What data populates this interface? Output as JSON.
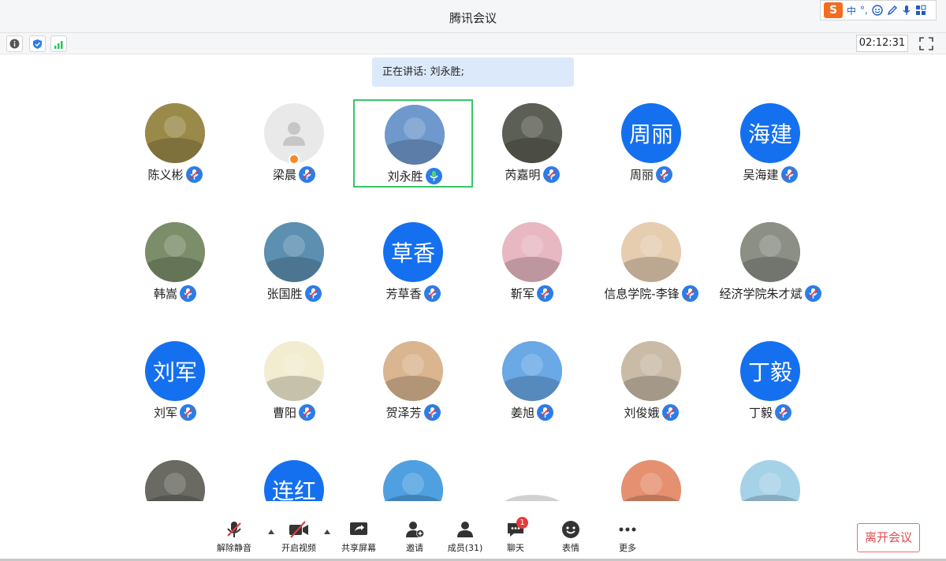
{
  "window": {
    "title": "腾讯会议"
  },
  "ime": {
    "lang": "中",
    "dot": "°,",
    "icons": [
      "smile-icon",
      "pen-icon",
      "mic-icon",
      "grid-icon"
    ]
  },
  "toolbar": {
    "timer": "02:12:31"
  },
  "speaking": {
    "text": "正在讲话: 刘永胜;"
  },
  "participants": [
    {
      "name": "陈义彬",
      "initials": "",
      "photo": "#9a8a4a"
    },
    {
      "name": "梁晨",
      "initials": "",
      "photo": "#e9e9e9"
    },
    {
      "name": "刘永胜",
      "initials": "",
      "photo": "#6f99cc"
    },
    {
      "name": "芮嘉明",
      "initials": "",
      "photo": "#5c5f55"
    },
    {
      "name": "周丽",
      "initials": "周丽",
      "photo": "#1470ef"
    },
    {
      "name": "吴海建",
      "initials": "海建",
      "photo": "#1470ef"
    },
    {
      "name": "韩嵩",
      "initials": "",
      "photo": "#7c8d6a"
    },
    {
      "name": "张国胜",
      "initials": "",
      "photo": "#5c8fb0"
    },
    {
      "name": "芳草香",
      "initials": "草香",
      "photo": "#1470ef"
    },
    {
      "name": "靳军",
      "initials": "",
      "photo": "#e8b8c2"
    },
    {
      "name": "信息学院-李锋",
      "initials": "",
      "photo": "#e6cdb0"
    },
    {
      "name": "经济学院朱才斌",
      "initials": "",
      "photo": "#8b8f85"
    },
    {
      "name": "刘军",
      "initials": "刘军",
      "photo": "#1470ef"
    },
    {
      "name": "曹阳",
      "initials": "",
      "photo": "#f2ecd0"
    },
    {
      "name": "贺泽芳",
      "initials": "",
      "photo": "#d9b590"
    },
    {
      "name": "姜旭",
      "initials": "",
      "photo": "#6aa8e6"
    },
    {
      "name": "刘俊娥",
      "initials": "",
      "photo": "#c9bba6"
    },
    {
      "name": "丁毅",
      "initials": "丁毅",
      "photo": "#1470ef"
    },
    {
      "name": "",
      "initials": "",
      "photo": "#6a6a62"
    },
    {
      "name": "",
      "initials": "连红",
      "photo": "#1470ef"
    },
    {
      "name": "",
      "initials": "",
      "photo": "#4fa0e0"
    },
    {
      "name": "",
      "initials": "",
      "photo": "#ffffff"
    },
    {
      "name": "",
      "initials": "",
      "photo": "#e59070"
    },
    {
      "name": "",
      "initials": "",
      "photo": "#a6d2e8"
    }
  ],
  "controls": {
    "unmute": "解除静音",
    "video": "开启视频",
    "share": "共享屏幕",
    "invite": "邀请",
    "members": "成员(31)",
    "chat": "聊天",
    "chat_badge": "1",
    "emoji": "表情",
    "more": "更多",
    "leave": "离开会议"
  }
}
